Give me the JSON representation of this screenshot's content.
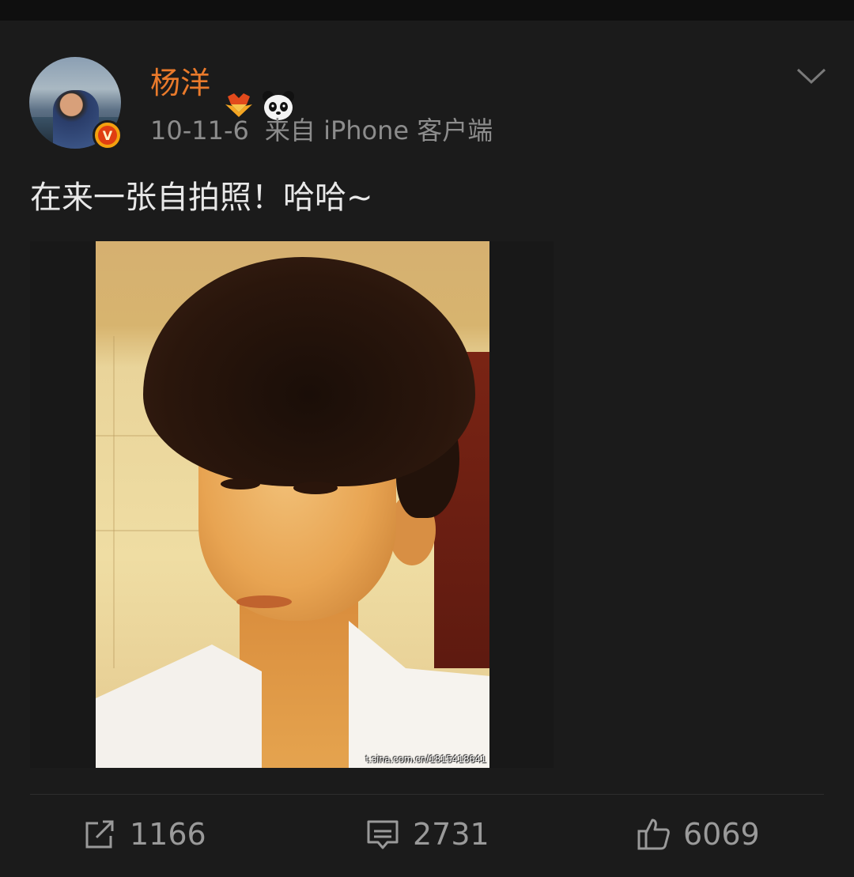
{
  "post": {
    "user": {
      "name": "杨洋"
    },
    "meta": {
      "date": "10-11-6",
      "source": "来自 iPhone 客户端"
    },
    "text": "在来一张自拍照！哈哈~",
    "image": {
      "watermark": "t.sina.com.cn/1815418641"
    },
    "actions": {
      "repost_count": "1166",
      "comment_count": "2731",
      "like_count": "6069"
    }
  },
  "icons": {
    "verified": "verified-v-icon",
    "crown": "crown-badge-icon",
    "panda": "panda-badge-icon",
    "more": "chevron-down-icon",
    "repost": "repost-icon",
    "comment": "comment-icon",
    "like": "thumbs-up-icon"
  },
  "colors": {
    "username": "#ea7a2b",
    "background": "#1b1b1b",
    "badge": "#f3a10f"
  }
}
